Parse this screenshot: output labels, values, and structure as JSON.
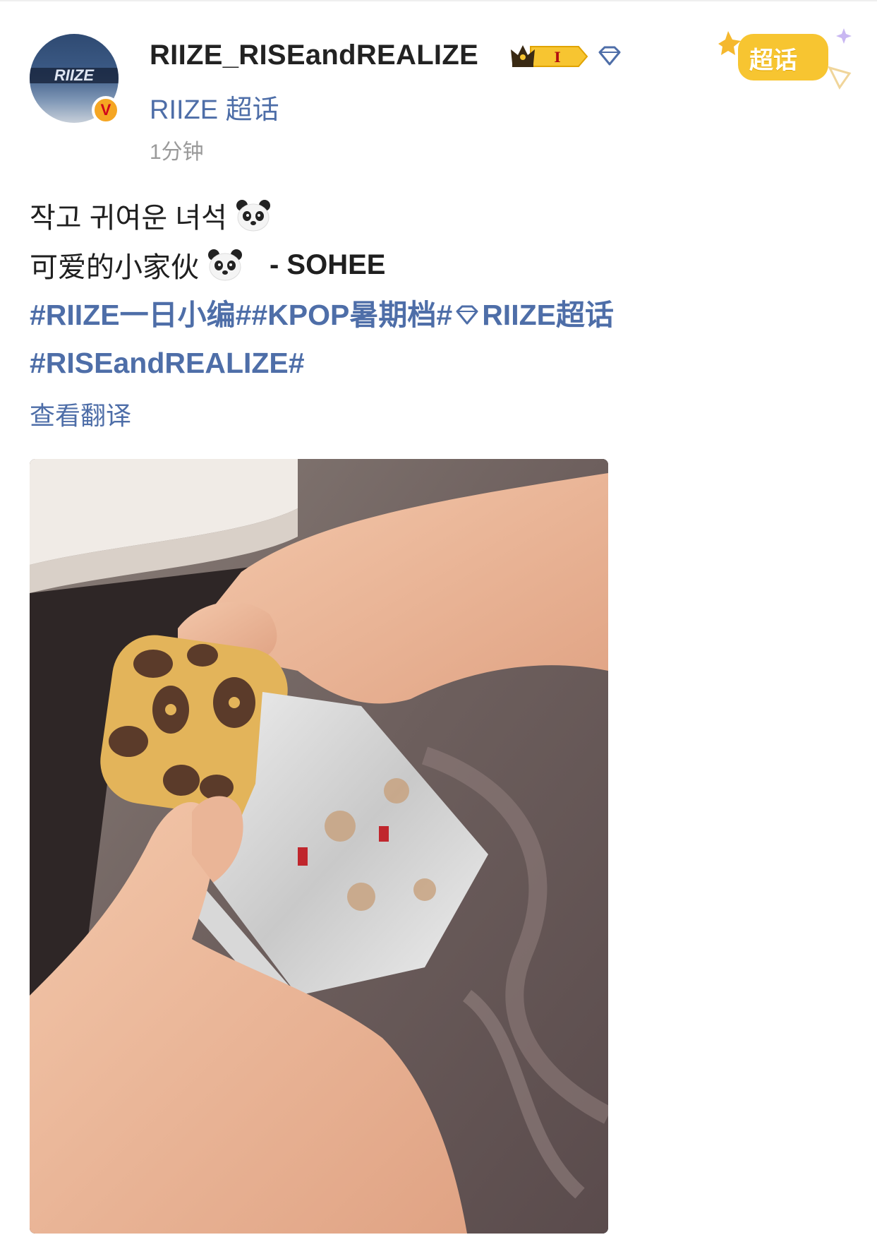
{
  "post": {
    "username": "RIIZE_RISEandREALIZE",
    "level_badge": "I",
    "supertopic_link": "RIIZE 超话",
    "timestamp": "1分钟",
    "super_badge_label": "超话",
    "avatar_logo_text": "RIIZE",
    "verified_mark": "V"
  },
  "content": {
    "line1": "작고 귀여운 녀석",
    "line2": "可爱的小家伙",
    "signature": "- SOHEE",
    "hashtag_row1": [
      "#RIIZE一日小编#",
      "#KPOP暑期档#",
      "RIIZE超话"
    ],
    "hashtag_row2": "#RISEandREALIZE#",
    "translate_label": "查看翻译"
  },
  "icons": {
    "crown": "crown-icon",
    "diamond": "diamond-icon",
    "panda": "panda-emoji-icon",
    "verified": "verified-badge-icon"
  },
  "colors": {
    "link": "#4e6ea8",
    "text": "#1f1f1f",
    "muted": "#9a9a9a",
    "badge_gold": "#f5c518",
    "verified_orange": "#f5a623"
  }
}
